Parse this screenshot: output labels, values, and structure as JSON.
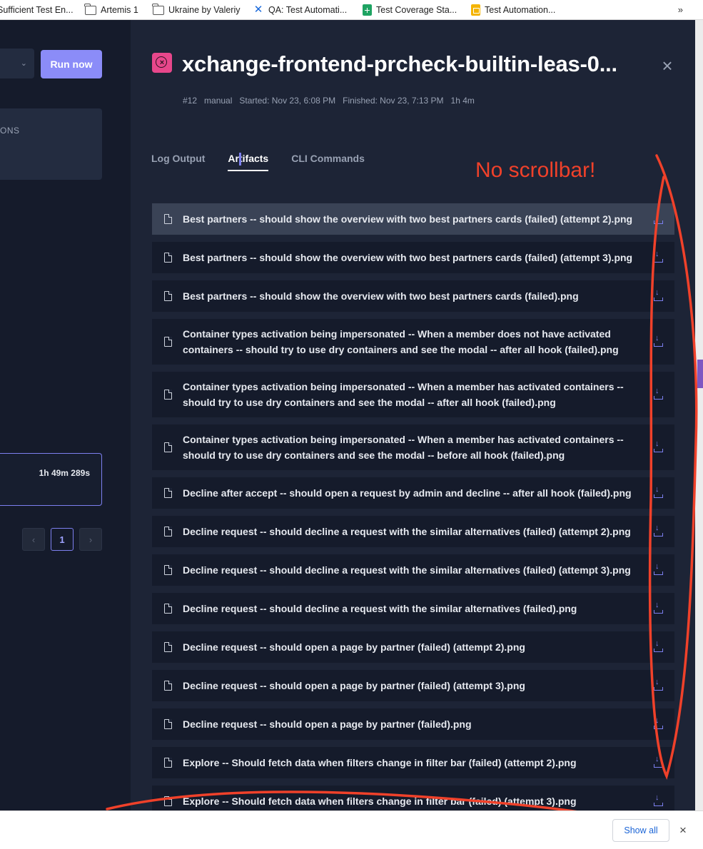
{
  "bookmarks": {
    "items": [
      {
        "label": "Sufficient Test En...",
        "icon": "folder-icon"
      },
      {
        "label": "Artemis 1",
        "icon": "folder-icon"
      },
      {
        "label": "Ukraine by Valeriy",
        "icon": "folder-icon"
      },
      {
        "label": "QA: Test Automati...",
        "icon": "confluence-icon"
      },
      {
        "label": "Test Coverage Sta...",
        "icon": "sheets-icon"
      },
      {
        "label": "Test Automation...",
        "icon": "slides-icon"
      }
    ],
    "more": "»"
  },
  "left": {
    "run_now": "Run now",
    "card_heading": "ONS",
    "run_duration": "1h 49m 289s",
    "pagination": {
      "prev": "‹",
      "current": "1",
      "next": "›"
    }
  },
  "drawer": {
    "status_symbol": "×",
    "title": "xchange-frontend-prcheck-builtin-leas-0...",
    "close": "×",
    "meta": {
      "run_number": "#12",
      "trigger": "manual",
      "started": "Started: Nov 23, 6:08 PM",
      "finished": "Finished: Nov 23, 7:13 PM",
      "duration": "1h 4m"
    },
    "tabs": [
      {
        "label": "Log Output"
      },
      {
        "label": "Artifacts"
      },
      {
        "label": "CLI Commands"
      }
    ],
    "artifacts": [
      "Best partners -- should show the overview with two best partners cards (failed) (attempt 2).png",
      "Best partners -- should show the overview with two best partners cards (failed) (attempt 3).png",
      "Best partners -- should show the overview with two best partners cards (failed).png",
      "Container types activation being impersonated -- When a member does not have activated containers -- should try to use dry containers and see the modal -- after all hook (failed).png",
      "Container types activation being impersonated -- When a member has activated containers -- should try to use dry containers and see the modal -- after all hook (failed).png",
      "Container types activation being impersonated -- When a member has activated containers -- should try to use dry containers and see the modal -- before all hook (failed).png",
      "Decline after accept -- should open a request by admin and decline -- after all hook (failed).png",
      "Decline request -- should decline a request with the similar alternatives (failed) (attempt 2).png",
      "Decline request -- should decline a request with the similar alternatives (failed) (attempt 3).png",
      "Decline request -- should decline a request with the similar alternatives (failed).png",
      "Decline request -- should open a page by partner (failed) (attempt 2).png",
      "Decline request -- should open a page by partner (failed) (attempt 3).png",
      "Decline request -- should open a page by partner (failed).png",
      "Explore -- Should fetch data when filters change in filter bar (failed) (attempt 2).png",
      "Explore -- Should fetch data when filters change in filter bar (failed) (attempt 3).png"
    ]
  },
  "annotation": {
    "text": "No scrollbar!",
    "color": "#f0412a"
  },
  "download_bar": {
    "show_all": "Show all",
    "close": "×"
  },
  "colors": {
    "accent": "#8b8cf8",
    "drawer_bg": "#1d2436",
    "row_bg": "#151b2b",
    "failed": "#e7478b"
  }
}
